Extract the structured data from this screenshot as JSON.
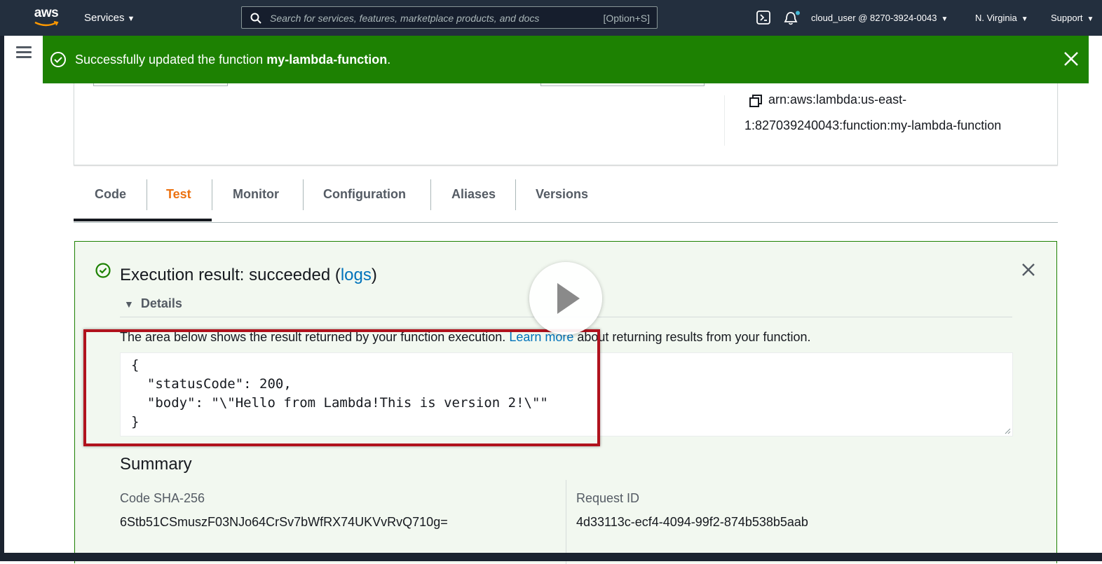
{
  "nav": {
    "logo_text": "aws",
    "services_label": "Services",
    "search_placeholder": "Search for services, features, marketplace products, and docs",
    "search_shortcut": "[Option+S]",
    "user_label": "cloud_user @ 8270-3924-0043",
    "region_label": "N. Virginia",
    "support_label": "Support",
    "icons": [
      "cloudshell-icon",
      "notifications-bell-icon"
    ]
  },
  "flash": {
    "prefix": "Successfully updated the function ",
    "function_name": "my-lambda-function",
    "suffix": ".",
    "color": "#1d8102"
  },
  "overview": {
    "arn_line1": "arn:aws:lambda:us-east-",
    "arn_line2": "1:827039240043:function:my-lambda-function"
  },
  "tabs": [
    {
      "label": "Code"
    },
    {
      "label": "Test",
      "active": true
    },
    {
      "label": "Monitor"
    },
    {
      "label": "Configuration"
    },
    {
      "label": "Aliases"
    },
    {
      "label": "Versions"
    }
  ],
  "result": {
    "title_prefix": "Execution result: succeeded (",
    "logs_link": "logs",
    "title_suffix": ")",
    "details_label": "Details",
    "description_before": "The area below shows the result returned by your function execution. ",
    "learn_more_link": "Learn more",
    "description_after": " about returning results from your function.",
    "code_lines": [
      "{",
      "  \"statusCode\": 200,",
      "  \"body\": \"\\\"Hello from Lambda!This is version 2!\\\"\"",
      "}"
    ],
    "summary_title": "Summary",
    "summary": {
      "code_sha_label": "Code SHA-256",
      "code_sha_value": "6Stb51CSmuszF03NJo64CrSv7bWfRX74UKVvRvQ710g=",
      "request_id_label": "Request ID",
      "request_id_value": "4d33113c-ecf4-4094-99f2-874b538b5aab"
    }
  },
  "colors": {
    "nav_bg": "#232f3e",
    "accent_orange": "#ec7211",
    "link_blue": "#0073bb",
    "success_green": "#1d8102",
    "highlight_red": "#b0121d"
  }
}
